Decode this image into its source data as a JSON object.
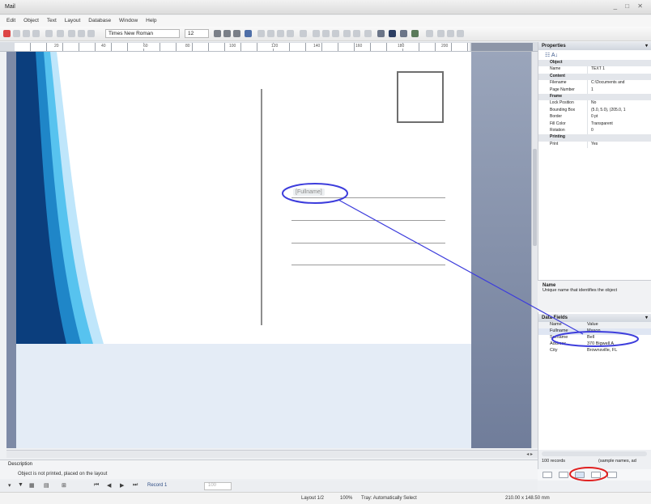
{
  "window": {
    "title": "Mail",
    "controls": "_ □ ✕"
  },
  "menu": [
    "Edit",
    "Object",
    "Text",
    "Layout",
    "Database",
    "Window",
    "Help"
  ],
  "toolbar": {
    "font": "Times New Roman",
    "size": "12"
  },
  "ruler_ticks": [
    "20",
    "40",
    "60",
    "80",
    "100",
    "120",
    "140",
    "160",
    "180",
    "200"
  ],
  "page": {
    "placeholder": "[Fullname]"
  },
  "properties": {
    "header": "Properties",
    "rows": [
      {
        "k": "Object",
        "v": "",
        "section": true
      },
      {
        "k": "Name",
        "v": "TEXT 1"
      },
      {
        "k": "Content",
        "v": "",
        "section": true
      },
      {
        "k": "Filename",
        "v": "C:\\Documents and"
      },
      {
        "k": "Page Number",
        "v": "1"
      },
      {
        "k": "Frame",
        "v": "",
        "section": true
      },
      {
        "k": "Lock Position",
        "v": "No"
      },
      {
        "k": "Bounding Box",
        "v": "(5.0, 5.0), (205.0, 1"
      },
      {
        "k": "Border",
        "v": "0 pt"
      },
      {
        "k": "Fill Color",
        "v": "Transparent"
      },
      {
        "k": "Rotation",
        "v": "0"
      },
      {
        "k": "Printing",
        "v": "",
        "section": true
      },
      {
        "k": "Print",
        "v": "Yes"
      }
    ],
    "desc_title": "Name",
    "desc_text": "Unique name that identifies the object"
  },
  "data_fields": {
    "header": "Data Fields",
    "columns": [
      "Name",
      "Value"
    ],
    "rows": [
      {
        "k": "Fullname",
        "v": "Mason",
        "sel": true
      },
      {
        "k": "Surname",
        "v": "Bell"
      },
      {
        "k": "Address",
        "v": "370 Bigwell A"
      },
      {
        "k": "City",
        "v": "Brownsville, FL"
      }
    ]
  },
  "records": {
    "count": "100 records",
    "source": "(sample names, ad"
  },
  "description": {
    "label": "Description",
    "text": "Object is not printed, placed on the layout"
  },
  "nav": {
    "record": "Record 1",
    "page": "100"
  },
  "status": {
    "layout": "Layout 1/2",
    "zoom": "100%",
    "tray": "Tray: Automatically Select",
    "pagesize": "210.00 x 148.50 mm"
  },
  "annotation_color": "#3d3ddc",
  "highlight_color": "#e02020"
}
